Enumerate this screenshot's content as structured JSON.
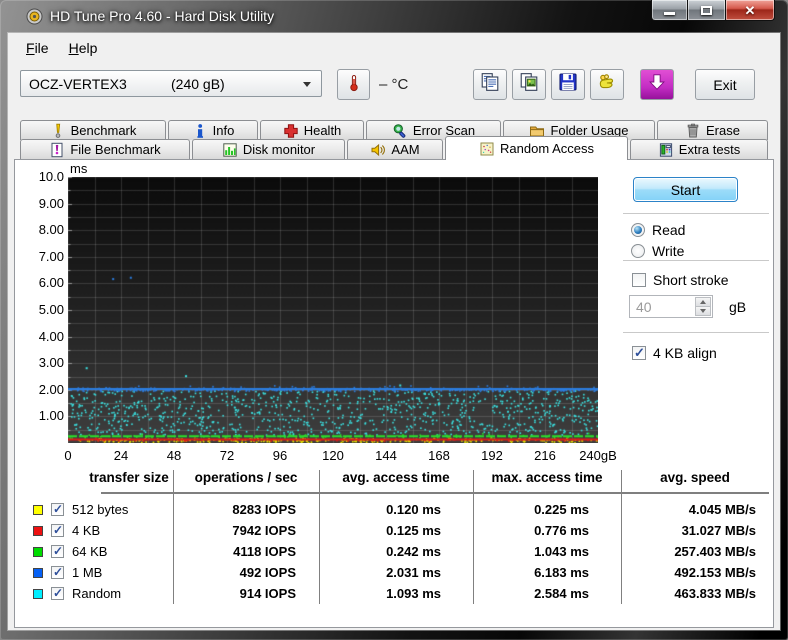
{
  "window": {
    "title": "HD Tune Pro 4.60 - Hard Disk Utility"
  },
  "menu": {
    "items": [
      {
        "label": "File"
      },
      {
        "label": "Help"
      }
    ]
  },
  "toolbar": {
    "drive_name": "OCZ-VERTEX3",
    "drive_size": "(240 gB)",
    "temp_value": "–",
    "temp_unit": "°C",
    "buttons": [
      {
        "id": "copy-text-button",
        "icon": "copy-text-icon"
      },
      {
        "id": "copy-image-button",
        "icon": "copy-image-icon"
      },
      {
        "id": "save-screenshot-button",
        "icon": "save-icon"
      },
      {
        "id": "donate-button",
        "icon": "donate-hand-icon"
      },
      {
        "id": "download-button",
        "icon": "download-arrow-icon",
        "accent": "#c32cc3"
      }
    ],
    "exit_label": "Exit"
  },
  "tabs": {
    "row1": [
      {
        "label": "Benchmark",
        "icon": "benchmark-icon"
      },
      {
        "label": "Info",
        "icon": "info-icon"
      },
      {
        "label": "Health",
        "icon": "health-icon"
      },
      {
        "label": "Error Scan",
        "icon": "error-scan-icon"
      },
      {
        "label": "Folder Usage",
        "icon": "folder-usage-icon"
      },
      {
        "label": "Erase",
        "icon": "erase-icon"
      }
    ],
    "row2": [
      {
        "label": "File Benchmark",
        "icon": "file-benchmark-icon"
      },
      {
        "label": "Disk monitor",
        "icon": "disk-monitor-icon"
      },
      {
        "label": "AAM",
        "icon": "aam-icon"
      },
      {
        "label": "Random Access",
        "icon": "random-access-icon",
        "active": true
      },
      {
        "label": "Extra tests",
        "icon": "extra-tests-icon"
      }
    ],
    "active": "Random Access"
  },
  "controls": {
    "start_label": "Start",
    "read_label": "Read",
    "read_checked": true,
    "write_label": "Write",
    "write_checked": false,
    "short_stroke_label": "Short stroke",
    "short_stroke_checked": false,
    "short_stroke_value": "40",
    "short_stroke_unit": "gB",
    "short_stroke_enabled": false,
    "kb_align_label": "4 KB align",
    "kb_align_checked": true
  },
  "chart_data": {
    "type": "scatter",
    "x_unit": "gB",
    "y_unit": "ms",
    "xlim": [
      0,
      240
    ],
    "ylim": [
      0,
      10
    ],
    "grid": {
      "x_step": 12,
      "y_step": 0.5,
      "on": true
    },
    "x_ticks": [
      {
        "v": 0,
        "label": "0"
      },
      {
        "v": 24,
        "label": "24"
      },
      {
        "v": 48,
        "label": "48"
      },
      {
        "v": 72,
        "label": "72"
      },
      {
        "v": 96,
        "label": "96"
      },
      {
        "v": 120,
        "label": "120"
      },
      {
        "v": 144,
        "label": "144"
      },
      {
        "v": 168,
        "label": "168"
      },
      {
        "v": 192,
        "label": "192"
      },
      {
        "v": 216,
        "label": "216"
      },
      {
        "v": 240,
        "label": "240gB"
      }
    ],
    "y_ticks": [
      {
        "v": 10,
        "label": "10.0"
      },
      {
        "v": 9,
        "label": "9.00"
      },
      {
        "v": 8,
        "label": "8.00"
      },
      {
        "v": 7,
        "label": "7.00"
      },
      {
        "v": 6,
        "label": "6.00"
      },
      {
        "v": 5,
        "label": "5.00"
      },
      {
        "v": 4,
        "label": "4.00"
      },
      {
        "v": 3,
        "label": "3.00"
      },
      {
        "v": 2,
        "label": "2.00"
      },
      {
        "v": 1,
        "label": "1.00"
      }
    ],
    "series": [
      {
        "name": "Random",
        "color": "#3ae2e2",
        "type": "scatter",
        "y_min": 0.32,
        "y_max": 1.98,
        "count": 950
      },
      {
        "name": "512 bytes",
        "color": "#e8e800",
        "type": "dots",
        "y": 0.12,
        "jitter": 0.05,
        "count": 300
      },
      {
        "name": "64 KB",
        "color": "#2ae02a",
        "type": "line",
        "y": 0.25,
        "thickness": 2,
        "dot_count": 90,
        "jitter": 0.06,
        "dash": [
          9,
          2
        ]
      },
      {
        "name": "4 KB",
        "color": "#e01818",
        "type": "line",
        "y": 0.13,
        "thickness": 2,
        "dot_count": 60,
        "jitter": 0.02
      },
      {
        "name": "1 MB",
        "color": "#2b7de0",
        "type": "line",
        "y": 2.031,
        "thickness": 2,
        "dot_count": 450,
        "jitter": 0.035
      }
    ],
    "outliers": [
      {
        "x": 8,
        "y": 2.85,
        "color": "#3ae2e2"
      },
      {
        "x": 53,
        "y": 2.55,
        "color": "#3ae2e2"
      },
      {
        "x": 150,
        "y": 2.2,
        "color": "#3ae2e2"
      },
      {
        "x": 20,
        "y": 6.2,
        "color": "#2b7de0"
      },
      {
        "x": 28,
        "y": 6.25,
        "color": "#2b7de0"
      }
    ],
    "bg_top": "#0b0b0b",
    "bg_bottom": "#3f3f3f",
    "grid_color": "rgba(255,255,255,0.14)"
  },
  "table": {
    "headers": [
      "transfer size",
      "operations / sec",
      "avg. access time",
      "max. access time",
      "avg. speed"
    ],
    "rows": [
      {
        "color": "#ffff00",
        "checked": true,
        "label": "512 bytes",
        "ops": "8283 IOPS",
        "avg": "0.120 ms",
        "max": "0.225 ms",
        "speed": "4.045 MB/s"
      },
      {
        "color": "#ee1111",
        "checked": true,
        "label": "4 KB",
        "ops": "7942 IOPS",
        "avg": "0.125 ms",
        "max": "0.776 ms",
        "speed": "31.027 MB/s"
      },
      {
        "color": "#00dd00",
        "checked": true,
        "label": "64 KB",
        "ops": "4118 IOPS",
        "avg": "0.242 ms",
        "max": "1.043 ms",
        "speed": "257.403 MB/s"
      },
      {
        "color": "#0561f5",
        "checked": true,
        "label": "1 MB",
        "ops": "492 IOPS",
        "avg": "2.031 ms",
        "max": "6.183 ms",
        "speed": "492.153 MB/s"
      },
      {
        "color": "#00eeff",
        "checked": true,
        "label": "Random",
        "ops": "914 IOPS",
        "avg": "1.093 ms",
        "max": "2.584 ms",
        "speed": "463.833 MB/s"
      }
    ]
  }
}
